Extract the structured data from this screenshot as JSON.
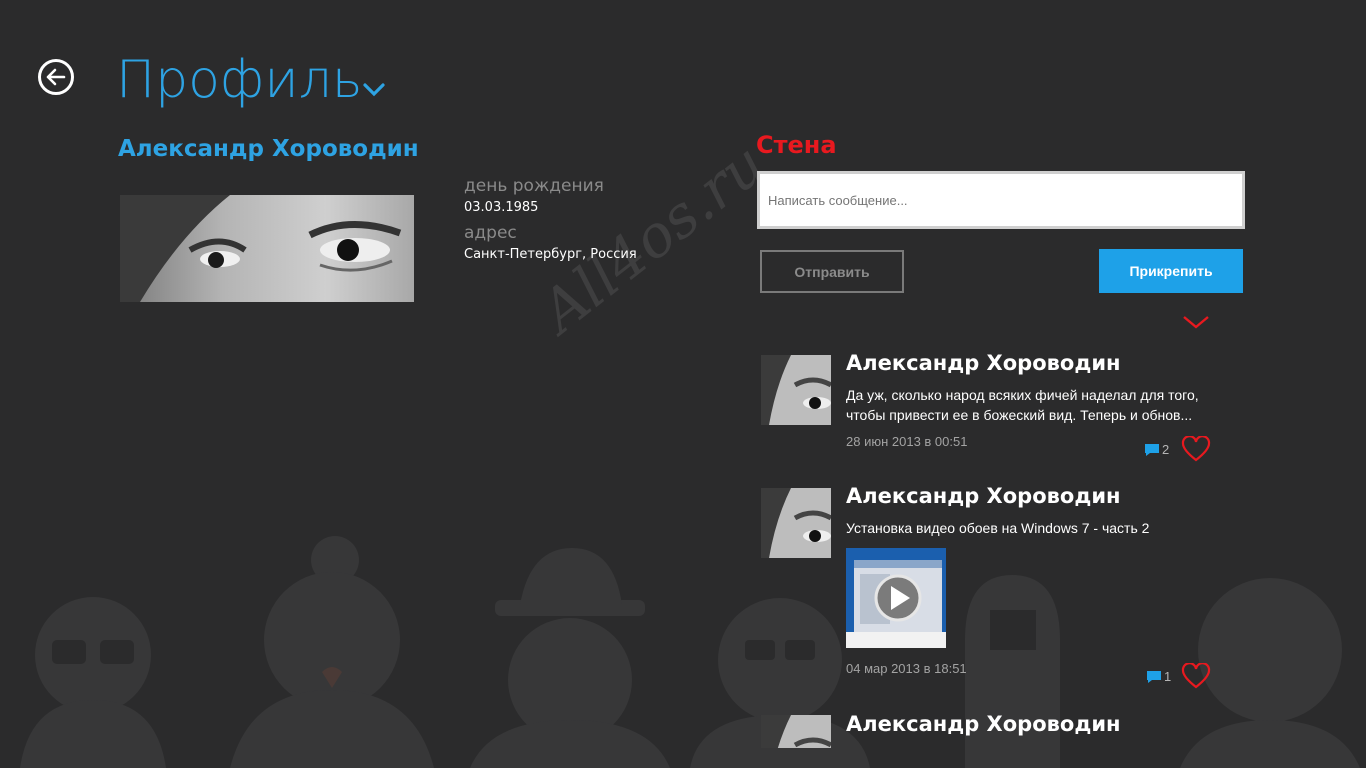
{
  "header": {
    "title": "Профиль",
    "back_icon": "back-arrow-icon",
    "chevron_icon": "chevron-down-icon"
  },
  "profile": {
    "name": "Александр Хороводин",
    "birthday_label": "день рождения",
    "birthday_value": "03.03.1985",
    "address_label": "адрес",
    "address_value": "Санкт-Петербург, Россия"
  },
  "watermark": "All4os.ru",
  "wall": {
    "title": "Стена",
    "input_placeholder": "Написать сообщение...",
    "send_label": "Отправить",
    "attach_label": "Прикрепить",
    "expand_icon": "chevron-down-icon",
    "posts": [
      {
        "author": "Александр Хороводин",
        "text": "Да уж, сколько народ всяких фичей наделал для того, чтобы привести ее в божеский вид. Теперь и обнов...",
        "date": "28 июн 2013 в 00:51",
        "comments": "2"
      },
      {
        "author": "Александр Хороводин",
        "text": "Установка видео обоев на Windows 7 - часть 2",
        "date": "04 мар 2013 в 18:51",
        "comments": "1"
      },
      {
        "author": "Александр Хороводин"
      }
    ]
  },
  "colors": {
    "background": "#2b2b2c",
    "accent_blue": "#2ea3e3",
    "wall_red": "#e8191f",
    "attach_blue": "#1ea1e8"
  }
}
